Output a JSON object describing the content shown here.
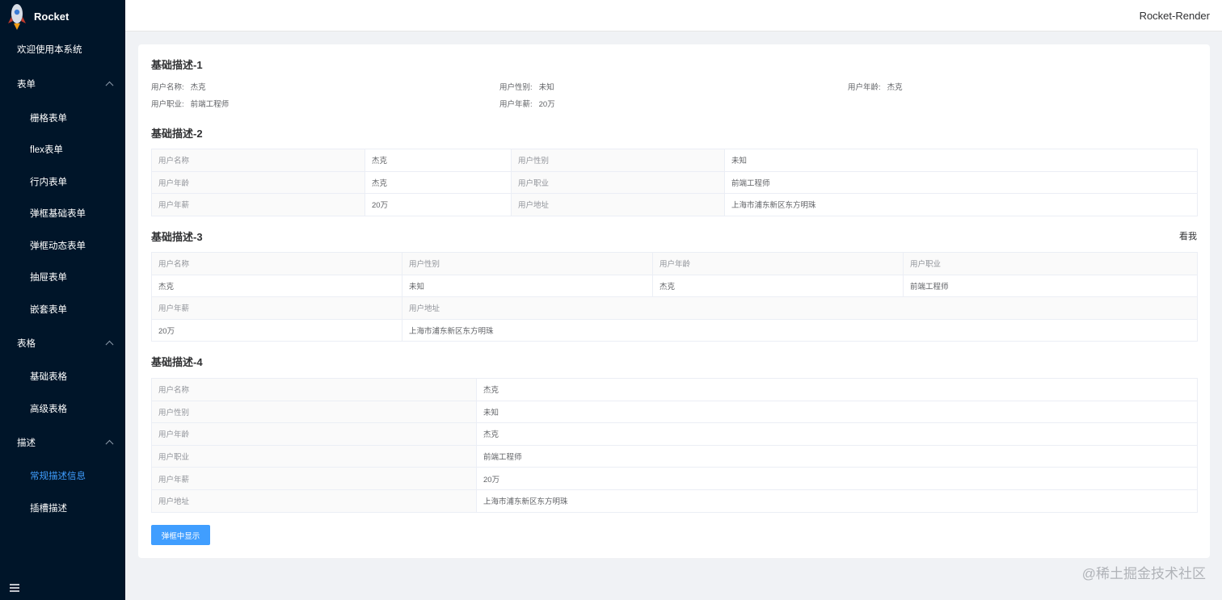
{
  "app": {
    "name": "Rocket",
    "header_brand": "Rocket-Render"
  },
  "menu": {
    "welcome": "欢迎使用本系统",
    "form": {
      "label": "表单",
      "items": [
        "栅格表单",
        "flex表单",
        "行内表单",
        "弹框基础表单",
        "弹框动态表单",
        "抽屉表单",
        "嵌套表单"
      ]
    },
    "table": {
      "label": "表格",
      "items": [
        "基础表格",
        "高级表格"
      ]
    },
    "desc": {
      "label": "描述",
      "items": [
        "常规描述信息",
        "插槽描述"
      ]
    }
  },
  "sections": {
    "s1": {
      "title": "基础描述-1",
      "row1": [
        {
          "label": "用户名称:",
          "value": "杰克"
        },
        {
          "label": "用户性别:",
          "value": "未知"
        },
        {
          "label": "用户年龄:",
          "value": "杰克"
        }
      ],
      "row2": [
        {
          "label": "用户职业:",
          "value": "前端工程师"
        },
        {
          "label": "用户年薪:",
          "value": "20万"
        }
      ]
    },
    "s2": {
      "title": "基础描述-2",
      "rows": [
        [
          "用户名称",
          "杰克",
          "用户性别",
          "未知"
        ],
        [
          "用户年龄",
          "杰克",
          "用户职业",
          "前端工程师"
        ],
        [
          "用户年薪",
          "20万",
          "用户地址",
          "上海市浦东新区东方明珠"
        ]
      ]
    },
    "s3": {
      "title": "基础描述-3",
      "extra": "看我",
      "row1_labels": [
        "用户名称",
        "用户性别",
        "用户年龄",
        "用户职业"
      ],
      "row1_values": [
        "杰克",
        "未知",
        "杰克",
        "前端工程师"
      ],
      "row2_labels": [
        "用户年薪",
        "用户地址"
      ],
      "row2_values": [
        "20万",
        "上海市浦东新区东方明珠"
      ]
    },
    "s4": {
      "title": "基础描述-4",
      "rows": [
        [
          "用户名称",
          "杰克"
        ],
        [
          "用户性别",
          "未知"
        ],
        [
          "用户年龄",
          "杰克"
        ],
        [
          "用户职业",
          "前端工程师"
        ],
        [
          "用户年薪",
          "20万"
        ],
        [
          "用户地址",
          "上海市浦东新区东方明珠"
        ]
      ]
    }
  },
  "button": {
    "label": "弹框中显示"
  },
  "watermark": "@稀土掘金技术社区",
  "colors": {
    "sidebar_bg": "#001529",
    "accent": "#409eff"
  }
}
